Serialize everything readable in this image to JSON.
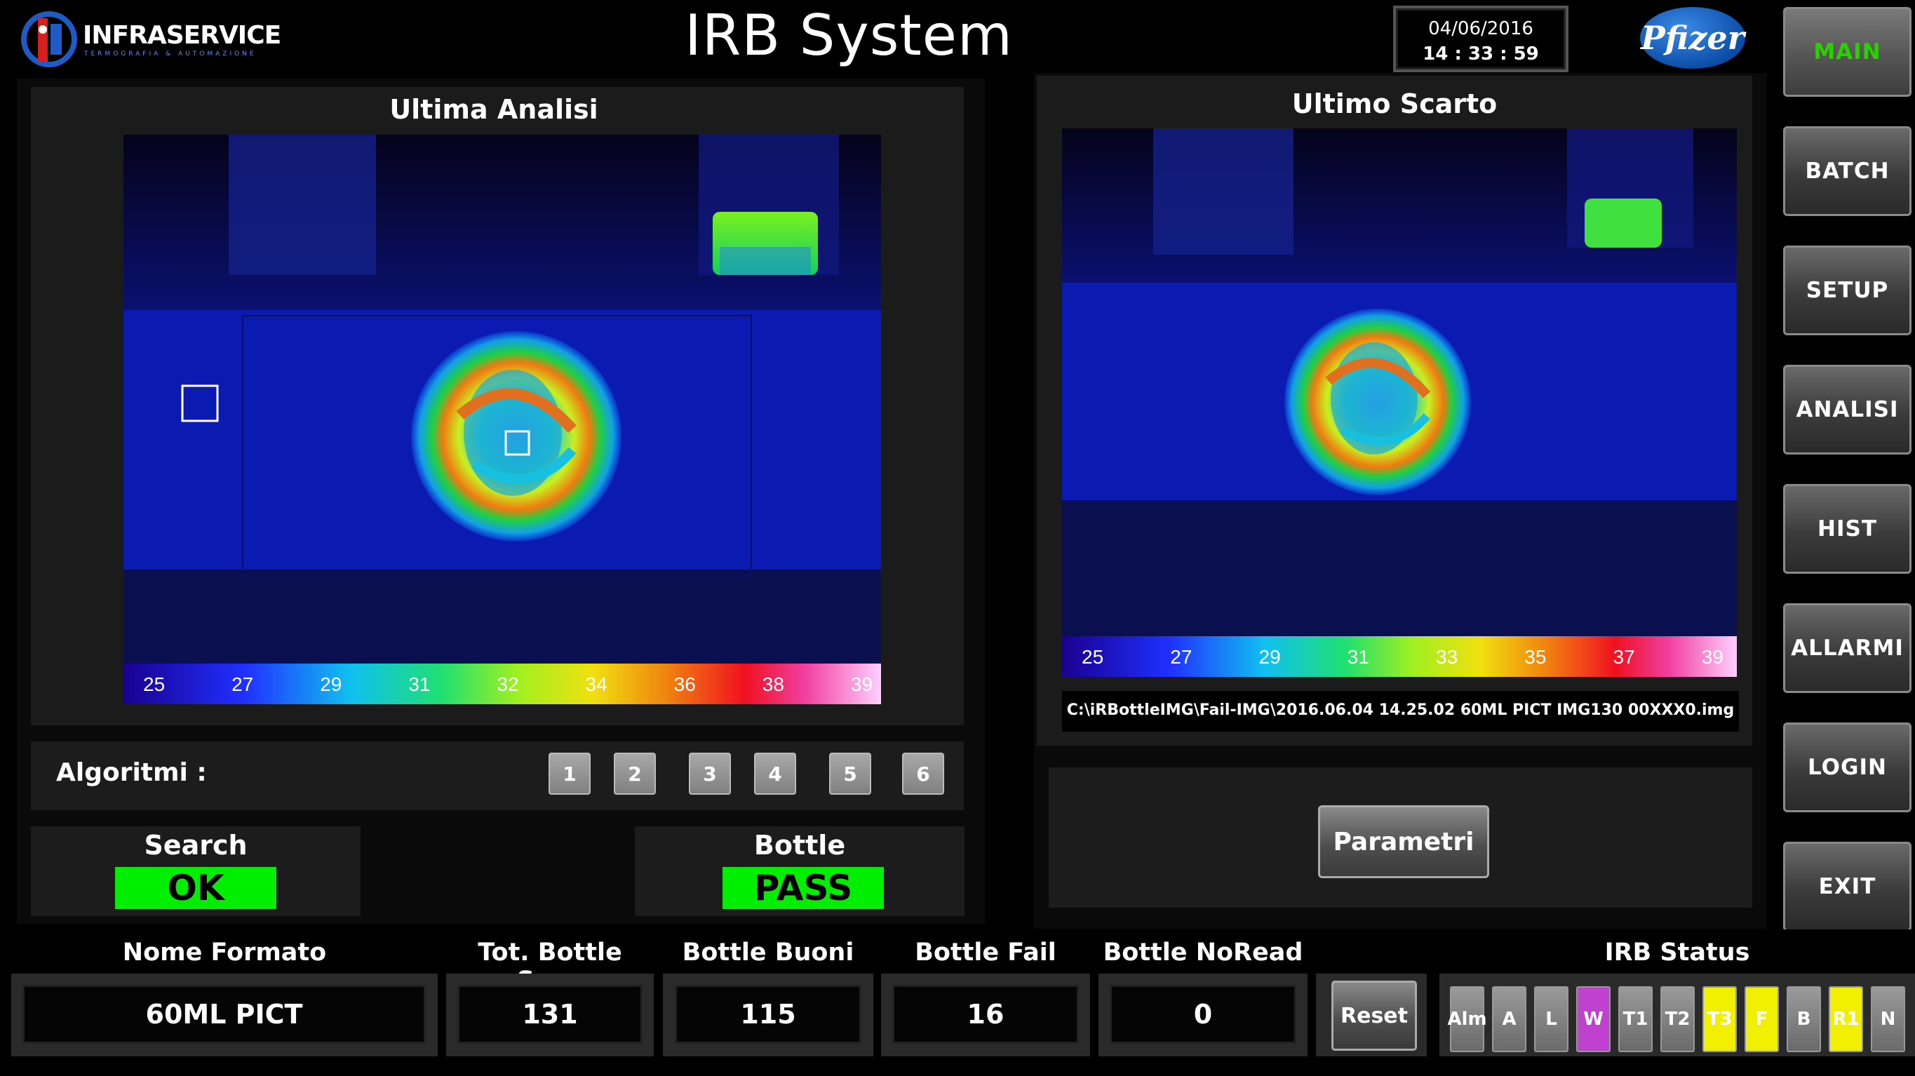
{
  "header": {
    "brand": "INFRASERVICE",
    "brand_tagline": "TERMOGRAFIA & AUTOMAZIONE",
    "title": "IRB System",
    "date": "04/06/2016",
    "time": "14 : 33 : 59",
    "client_logo": "Pfizer"
  },
  "nav": [
    {
      "label": "MAIN",
      "active": true
    },
    {
      "label": "BATCH"
    },
    {
      "label": "SETUP"
    },
    {
      "label": "ANALISI"
    },
    {
      "label": "HIST"
    },
    {
      "label": "ALLARMI"
    },
    {
      "label": "LOGIN"
    },
    {
      "label": "EXIT"
    }
  ],
  "left_panel": {
    "title": "Ultima Analisi",
    "scale": [
      "25",
      "27",
      "29",
      "31",
      "32",
      "34",
      "36",
      "38",
      "39"
    ]
  },
  "right_panel": {
    "title": "Ultimo Scarto",
    "scale": [
      "25",
      "27",
      "29",
      "31",
      "33",
      "35",
      "37",
      "39"
    ],
    "file_path": "C:\\iRBottleIMG\\Fail-IMG\\2016.06.04 14.25.02 60ML PICT IMG130 00XXX0.img",
    "params_button": "Parametri"
  },
  "algoritmi": {
    "label": "Algoritmi :",
    "buttons": [
      "1",
      "2",
      "3",
      "4",
      "5",
      "6"
    ]
  },
  "search": {
    "label": "Search",
    "value": "OK"
  },
  "bottle": {
    "label": "Bottle",
    "value": "PASS"
  },
  "counters": {
    "nome_formato": {
      "label": "Nome Formato",
      "value": "60ML PICT"
    },
    "tot_scan": {
      "label": "Tot. Bottle Scan",
      "value": "131"
    },
    "buoni": {
      "label": "Bottle Buoni",
      "value": "115"
    },
    "fail": {
      "label": "Bottle Fail",
      "value": "16"
    },
    "noread": {
      "label": "Bottle NoRead",
      "value": "0"
    },
    "reset": "Reset"
  },
  "irb_status": {
    "title": "IRB Status",
    "chips": [
      {
        "label": "Alm",
        "color": "#7a7a7a"
      },
      {
        "label": "A",
        "color": "#7a7a7a"
      },
      {
        "label": "L",
        "color": "#7a7a7a"
      },
      {
        "label": "W",
        "color": "#c040d0"
      },
      {
        "label": "T1",
        "color": "#7a7a7a"
      },
      {
        "label": "T2",
        "color": "#7a7a7a"
      },
      {
        "label": "T3",
        "color": "#f0f000"
      },
      {
        "label": "F",
        "color": "#f0f000"
      },
      {
        "label": "B",
        "color": "#7a7a7a"
      },
      {
        "label": "R1",
        "color": "#f0f000"
      },
      {
        "label": "N",
        "color": "#7a7a7a"
      }
    ]
  },
  "colors": {
    "ok_green": "#00ee00",
    "active_nav": "#2bd000"
  }
}
